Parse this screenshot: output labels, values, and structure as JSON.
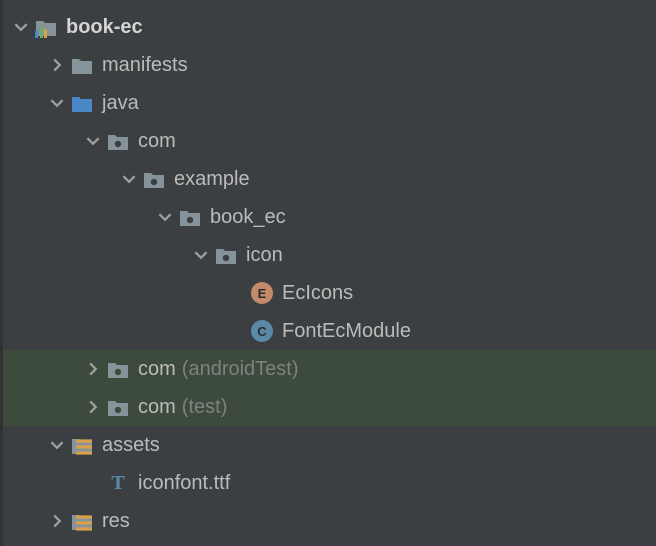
{
  "tree": {
    "root": {
      "label": "book-ec"
    },
    "manifests": {
      "label": "manifests"
    },
    "java": {
      "label": "java"
    },
    "com": {
      "label": "com"
    },
    "example": {
      "label": "example"
    },
    "book_ec": {
      "label": "book_ec"
    },
    "icon": {
      "label": "icon"
    },
    "ecicons": {
      "label": "EcIcons"
    },
    "fontecmodule": {
      "label": "FontEcModule"
    },
    "com_androidtest": {
      "label": "com",
      "suffix": "(androidTest)"
    },
    "com_test": {
      "label": "com",
      "suffix": "(test)"
    },
    "assets": {
      "label": "assets"
    },
    "iconfont": {
      "label": "iconfont.ttf"
    },
    "res": {
      "label": "res"
    }
  },
  "colors": {
    "folder": "#87939a",
    "java_folder": "#4a87c7",
    "package": "#87939a",
    "chevron": "#a0a0a0"
  }
}
